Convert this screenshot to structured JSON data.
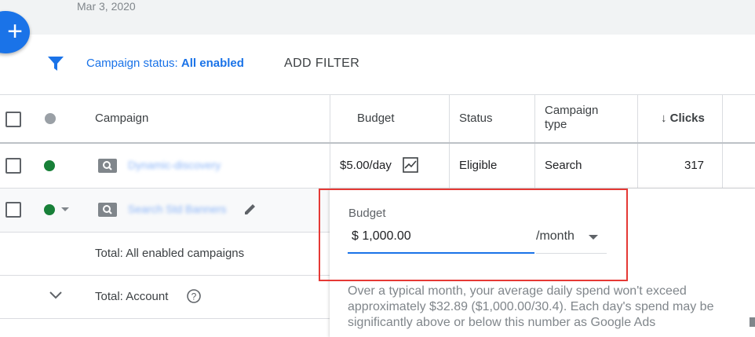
{
  "header": {
    "date": "Mar 3, 2020"
  },
  "fab": {
    "icon": "plus-icon",
    "label": "+"
  },
  "filter": {
    "status_label": "Campaign status:",
    "status_value": "All enabled",
    "add_filter": "ADD FILTER"
  },
  "table": {
    "columns": [
      "Campaign",
      "Budget",
      "Status",
      "Campaign type",
      "Clicks"
    ],
    "rows": [
      {
        "campaign": "Dynamic-discovery",
        "budget": "$5.00/day",
        "status": "Eligible",
        "type": "Search",
        "clicks": "317",
        "status_color": "#188038"
      },
      {
        "campaign": "Search Std Banners",
        "status_color": "#188038"
      }
    ],
    "totals": [
      {
        "label": "Total: All enabled campaigns"
      },
      {
        "label": "Total: Account"
      }
    ]
  },
  "budget_popup": {
    "label": "Budget",
    "value": "$ 1,000.00",
    "period": "/month",
    "help": "Over a typical month, your average daily spend won't exceed approximately $32.89 ($1,000.00/30.4). Each day's spend may be significantly above or below this number as Google Ads"
  },
  "colors": {
    "accent": "#1a73e8",
    "highlight": "#e53935",
    "enabled": "#188038"
  }
}
